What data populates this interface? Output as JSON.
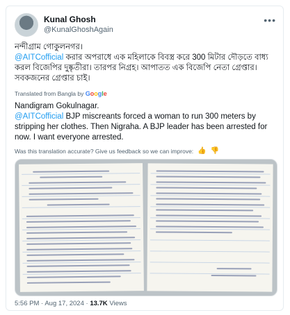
{
  "author": {
    "display_name": "Kunal Ghosh",
    "handle": "@KunalGhoshAgain"
  },
  "tweet": {
    "bn_line1": "নন্দীগ্রাম গোকুলনগর।",
    "bn_mention": "@AITCofficial",
    "bn_rest": " করার অপরাধে এক মহিলাকে বিবস্ত্র করে 300 মিটার দৌড়তে বাধ্য করল বিজেপির দুষ্কৃতীরা। তারপর নিগ্রহ। আপাতত এক বিজেপি নেতা গ্রেপ্তার। সবকজনের গ্রেপ্তার চাই।",
    "translated_label": "Translated from Bangla by",
    "google_label": "Google",
    "en_line1": "Nandigram Gokulnagar.",
    "en_mention": "@AITCofficial",
    "en_rest": " BJP miscreants forced a woman to run 300 meters by stripping her clothes. Then Nigraha. A BJP leader has been arrested for now. I want everyone arrested.",
    "feedback_prompt": "Was this translation accurate? Give us feedback so we can improve:"
  },
  "meta": {
    "time": "5:56 PM",
    "separator": "·",
    "date": "Aug 17, 2024",
    "views_count": "13.7K",
    "views_label": "Views"
  },
  "icons": {
    "more": "more-dots-icon",
    "thumbs_up": "thumbs-up-icon",
    "thumbs_down": "thumbs-down-icon"
  },
  "colors": {
    "link": "#1d9bf0",
    "secondary_text": "#536471"
  }
}
